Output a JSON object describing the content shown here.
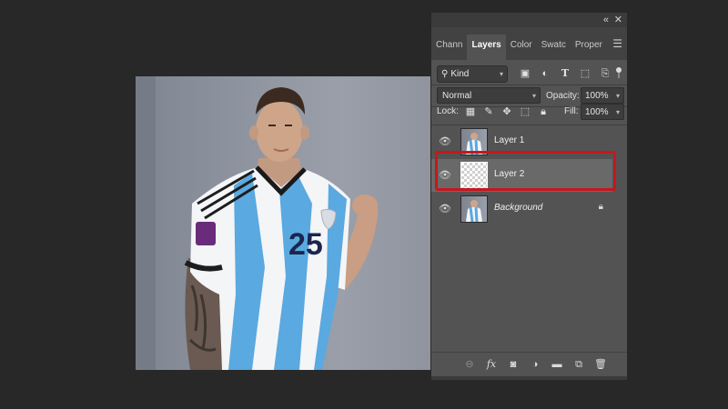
{
  "panel": {
    "tabs": [
      {
        "label": "Chann"
      },
      {
        "label": "Layers"
      },
      {
        "label": "Color"
      },
      {
        "label": "Swatc"
      },
      {
        "label": "Proper"
      }
    ],
    "filter": {
      "kind_label": "Kind"
    },
    "blend_mode": "Normal",
    "opacity_label": "Opacity:",
    "opacity_value": "100%",
    "lock_label": "Lock:",
    "fill_label": "Fill:",
    "fill_value": "100%",
    "layers": [
      {
        "name": "Layer 1",
        "thumb": "photo",
        "visible": true,
        "selected": false
      },
      {
        "name": "Layer 2",
        "thumb": "transparent",
        "visible": true,
        "selected": true
      },
      {
        "name": "Background",
        "thumb": "photo",
        "visible": true,
        "locked": true,
        "selected": false
      }
    ]
  },
  "photo": {
    "jersey_number": "25",
    "colors": {
      "background": "#8e949f",
      "jersey_blue": "#5aa9e0",
      "jersey_white": "#f4f5f7",
      "highlight": "#c8161d"
    }
  },
  "icons": {
    "collapse": "double-chevron-left-icon",
    "close": "close-icon",
    "panel_menu": "hamburger-menu-icon",
    "filter_types": [
      "image-filter-icon",
      "adjustment-filter-icon",
      "type-filter-icon",
      "shape-filter-icon",
      "smart-object-filter-icon"
    ],
    "locks": [
      "lock-transparent-pixels-icon",
      "lock-image-pixels-icon",
      "lock-position-icon",
      "lock-artboard-icon",
      "lock-all-icon"
    ],
    "bottom": [
      "link-layers-icon",
      "fx-icon",
      "add-mask-icon",
      "adjustment-layer-icon",
      "new-group-icon",
      "new-layer-icon",
      "delete-layer-icon"
    ]
  }
}
